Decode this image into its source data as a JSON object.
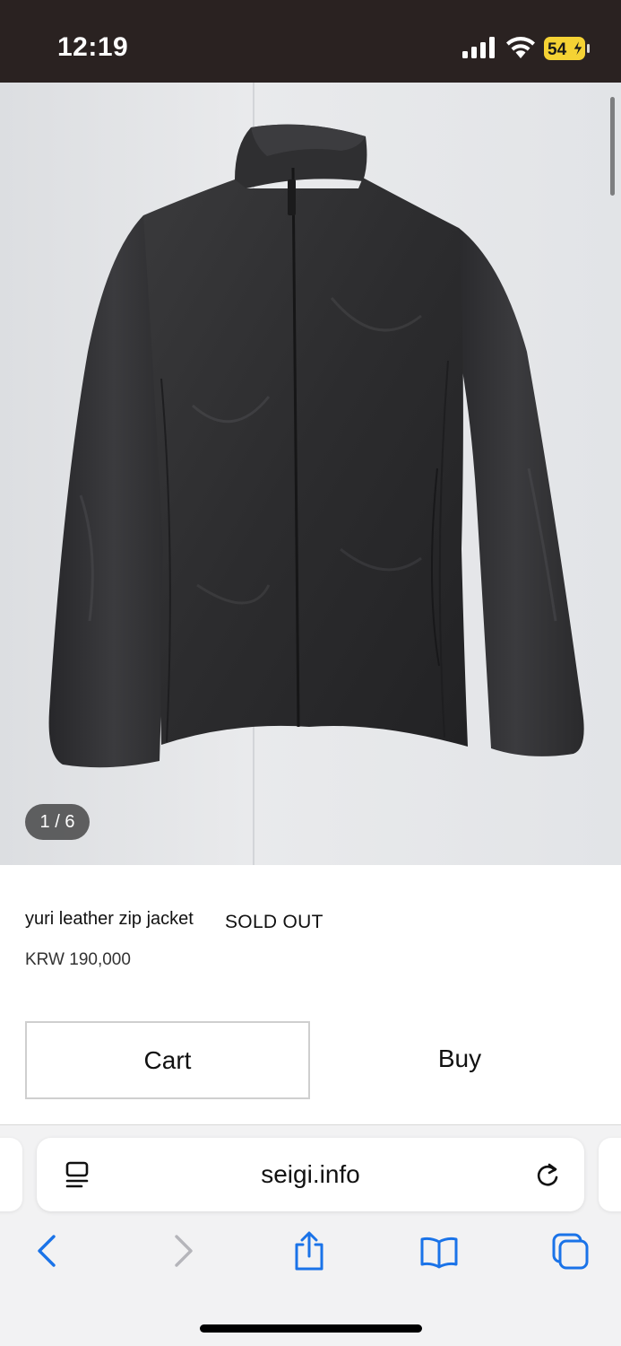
{
  "status_bar": {
    "time": "12:19",
    "battery_level": "54",
    "icons": [
      "signal-icon",
      "wifi-icon",
      "battery-charging-icon"
    ]
  },
  "gallery": {
    "counter": "1 / 6",
    "image_subject": "black leather zip jacket"
  },
  "product": {
    "name": "yuri leather zip jacket",
    "status": "SOLD OUT",
    "price": "KRW 190,000"
  },
  "actions": {
    "cart_label": "Cart",
    "buy_label": "Buy"
  },
  "browser": {
    "url": "seigi.info",
    "toolbar_icons": [
      "back-icon",
      "forward-icon",
      "share-icon",
      "bookmarks-icon",
      "tabs-icon"
    ],
    "accent_color": "#1a73e8"
  },
  "colors": {
    "status_bar_bg": "#2a2221",
    "battery_yellow": "#f5d234",
    "image_bg": "#e6e7e9"
  }
}
